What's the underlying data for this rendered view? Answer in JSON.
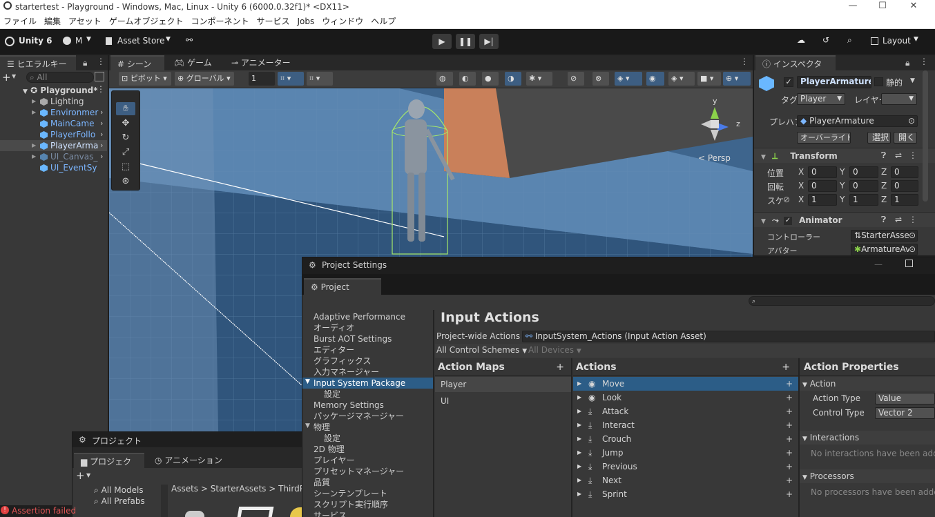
{
  "window": {
    "title": "startertest - Playground - Windows, Mac, Linux - Unity 6 (6000.0.32f1)* <DX11>",
    "controls": [
      "—",
      "☐",
      "✕"
    ]
  },
  "menu": [
    "ファイル",
    "編集",
    "アセット",
    "ゲームオブジェクト",
    "コンポーネント",
    "サービス",
    "Jobs",
    "ウィンドウ",
    "ヘルプ"
  ],
  "toolbar": {
    "unity_label": "Unity 6",
    "account_label": "M",
    "asset_store_label": "Asset Store",
    "layout_label": "Layout"
  },
  "hierarchy": {
    "tab": "ヒエラルキー",
    "search_placeholder": "All",
    "scene": "Playground*",
    "items": [
      {
        "label": "Lighting"
      },
      {
        "label": "Environmer"
      },
      {
        "label": "MainCame"
      },
      {
        "label": "PlayerFollo"
      },
      {
        "label": "PlayerArma"
      },
      {
        "label": "UI_Canvas_"
      },
      {
        "label": "UI_EventSy"
      }
    ]
  },
  "scene_tabs": [
    "シーン",
    "ゲーム",
    "アニメーター"
  ],
  "scene_toolbar": {
    "pivot": "ピボット",
    "global": "グローバル",
    "snap_value": "1",
    "persp": "Persp",
    "gizmo_y": "y",
    "gizmo_z": "z"
  },
  "inspector": {
    "tab": "インスペクター",
    "object_name": "PlayerArmature",
    "static_label": "静的",
    "tag_label": "タグ",
    "tag_value": "Player",
    "layer_label": "レイヤー",
    "prefab_label": "プレハブ",
    "prefab_value": "PlayerArmature",
    "override_label": "オーバーライド",
    "select_label": "選択",
    "open_label": "開く",
    "transform": {
      "title": "Transform",
      "rows": [
        {
          "label": "位置",
          "x": "0",
          "y": "0",
          "z": "0"
        },
        {
          "label": "回転",
          "x": "0",
          "y": "0",
          "z": "0"
        },
        {
          "label": "スケ",
          "x": "1",
          "y": "1",
          "z": "1"
        }
      ]
    },
    "animator": {
      "title": "Animator",
      "controller_label": "コントローラー",
      "controller_value": "StarterAsse",
      "avatar_label": "アバター",
      "avatar_value": "ArmatureAv"
    }
  },
  "project_settings": {
    "window_title": "Project Settings",
    "tab": "Project Settings",
    "list": [
      "Adaptive Performance",
      "オーディオ",
      "Burst AOT Settings",
      "エディター",
      "グラフィックス",
      "入力マネージャー",
      "Input System Package",
      "設定",
      "Memory Settings",
      "パッケージマネージャー",
      "物理",
      "設定",
      "2D 物理",
      "プレイヤー",
      "プリセットマネージャー",
      "品質",
      "シーンテンプレート",
      "スクリプト実行順序",
      "サービス"
    ],
    "heading": "Input Actions",
    "project_wide_label": "Project-wide Actions",
    "project_wide_value": "InputSystem_Actions (Input Action Asset)",
    "control_schemes": "All Control Schemes",
    "devices": "All Devices",
    "action_maps_title": "Action Maps",
    "action_maps": [
      "Player",
      "UI"
    ],
    "actions_title": "Actions",
    "actions": [
      "Move",
      "Look",
      "Attack",
      "Interact",
      "Crouch",
      "Jump",
      "Previous",
      "Next",
      "Sprint"
    ],
    "properties_title": "Action Properties",
    "action_section": "Action",
    "action_type_label": "Action Type",
    "action_type_value": "Value",
    "control_type_label": "Control Type",
    "control_type_value": "Vector 2",
    "interactions_section": "Interactions",
    "interactions_empty": "No interactions have been adde",
    "processors_section": "Processors",
    "processors_empty": "No processors have been adde"
  },
  "project": {
    "window_title": "プロジェクト",
    "tabs": [
      "プロジェクト",
      "アニメーション"
    ],
    "favorites": [
      "All Models",
      "All Prefabs"
    ],
    "breadcrumb": [
      "Assets",
      "StarterAssets",
      "ThirdP"
    ]
  },
  "console": {
    "message": "Assertion failed"
  }
}
